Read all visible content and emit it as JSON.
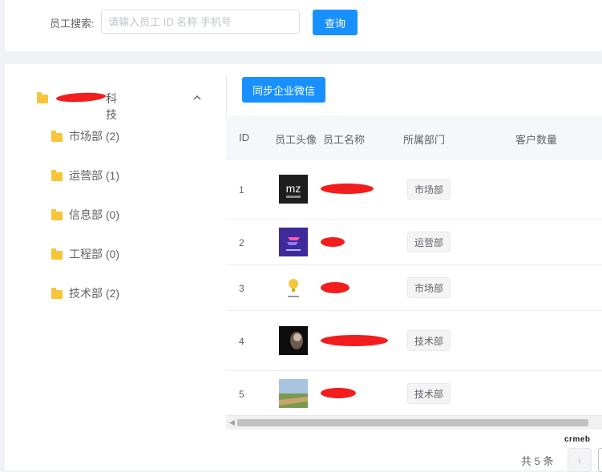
{
  "search": {
    "label": "员工搜索:",
    "placeholder": "请输入员工 ID 名称 手机号",
    "value": "",
    "query_button": "查询"
  },
  "tree": {
    "root_suffix": "科技",
    "items": [
      {
        "label": "市场部 (2)"
      },
      {
        "label": "运营部 (1)"
      },
      {
        "label": "信息部 (0)"
      },
      {
        "label": "工程部 (0)"
      },
      {
        "label": "技术部 (2)"
      }
    ]
  },
  "toolbar": {
    "sync_button": "同步企业微信"
  },
  "table": {
    "columns": [
      "ID",
      "员工头像",
      "员工名称",
      "所属部门",
      "客户数量"
    ],
    "rows": [
      {
        "id": "1",
        "dept": "市场部"
      },
      {
        "id": "2",
        "dept": "运营部"
      },
      {
        "id": "3",
        "dept": "市场部"
      },
      {
        "id": "4",
        "dept": "技术部"
      },
      {
        "id": "5",
        "dept": "技术部"
      }
    ]
  },
  "pagination": {
    "total": "共 5 条",
    "brand": "crmeb"
  },
  "colors": {
    "primary": "#1890ff",
    "folder": "#f8c43a",
    "redaction": "#f21d1d"
  }
}
